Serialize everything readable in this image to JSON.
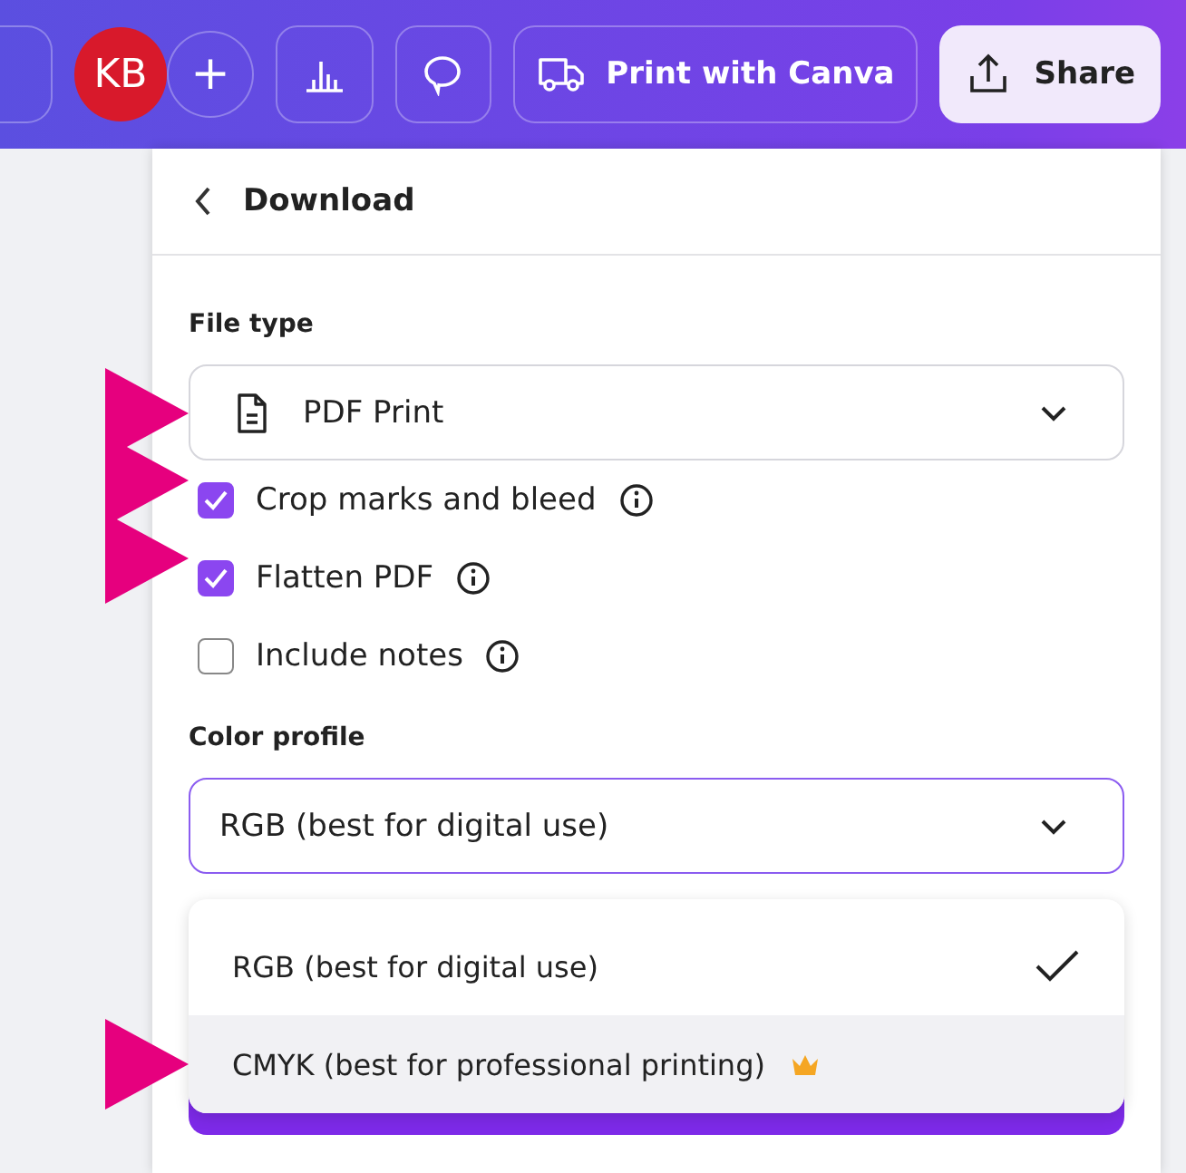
{
  "toolbar": {
    "avatar": "KB",
    "add_label": "+",
    "print_button": "Print with Canva",
    "share_button": "Share"
  },
  "panel": {
    "title": "Download",
    "file_type": {
      "label": "File type",
      "value": "PDF Print",
      "annotated": true
    },
    "options": [
      {
        "label": "Crop marks and bleed",
        "checked": true,
        "annotated": true
      },
      {
        "label": "Flatten PDF",
        "checked": true,
        "annotated": true
      },
      {
        "label": "Include notes",
        "checked": false,
        "annotated": false
      }
    ],
    "color_profile": {
      "label": "Color profile",
      "value": "RGB (best for digital use)",
      "menu": [
        {
          "label": "RGB (best for digital use)",
          "selected": true,
          "highlighted": false,
          "premium": false,
          "annotated": false
        },
        {
          "label": "CMYK (best for professional printing)",
          "selected": false,
          "highlighted": true,
          "premium": true,
          "annotated": true
        }
      ]
    }
  }
}
